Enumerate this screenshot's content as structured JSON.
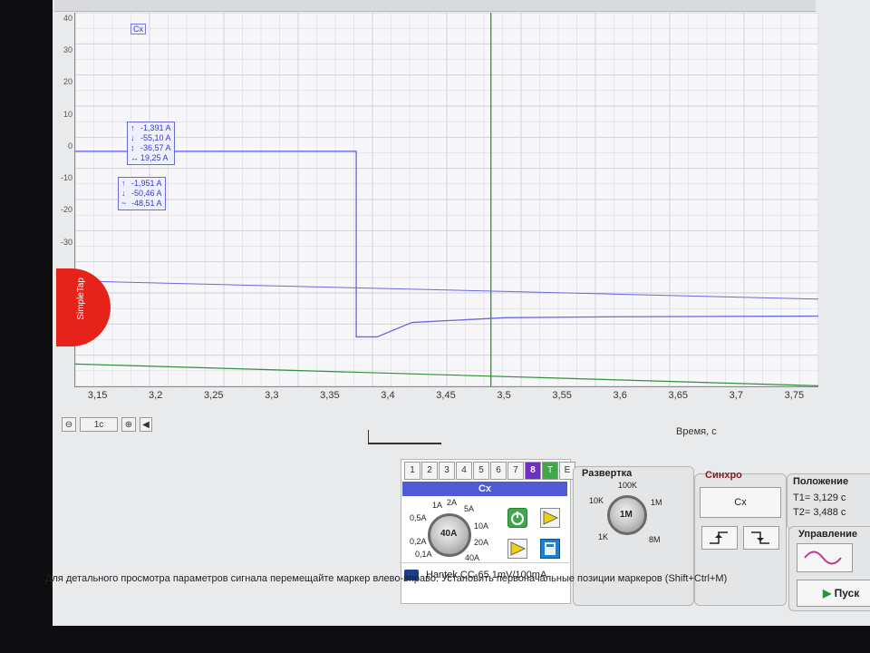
{
  "channel_tag": "Cx",
  "chart_data": {
    "type": "line",
    "xlabel": "Время, с",
    "x_ticks": [
      "3,15",
      "3,2",
      "3,25",
      "3,3",
      "3,35",
      "3,4",
      "3,45",
      "3,5",
      "3,55",
      "3,6",
      "3,65",
      "3,7",
      "3,75"
    ],
    "y_ticks": [
      "40",
      "30",
      "20",
      "10",
      "0",
      "-10",
      "-20",
      "-30"
    ],
    "xlim": [
      3.13,
      3.77
    ],
    "ylim": [
      -33,
      42
    ],
    "grid": true,
    "series": [
      {
        "x": [
          3.13,
          3.372,
          3.372,
          3.39,
          3.42,
          3.5,
          3.6,
          3.77
        ],
        "y": [
          -1.4,
          -1.4,
          -59.5,
          -59.5,
          -55,
          -53.5,
          -53.2,
          -53
        ]
      }
    ],
    "reference_lines": {
      "cursor_x": 3.488,
      "blue_h_level": -42,
      "green_h_level": -68
    }
  },
  "measure_box_1": [
    {
      "icon": "↑",
      "value": "-1,391 A"
    },
    {
      "icon": "↓",
      "value": "-55,10 A"
    },
    {
      "icon": "↕",
      "value": "-36,57 A"
    },
    {
      "icon": "↔",
      "value": "19,25 A"
    }
  ],
  "measure_box_2": [
    {
      "icon": "↑",
      "value": "-1,951 A"
    },
    {
      "icon": "↓",
      "value": "-50,46 A"
    },
    {
      "icon": "~",
      "value": "-48,51 A"
    }
  ],
  "simpletap_label": "SimpleTap",
  "nav": {
    "timebase": "1c",
    "zoom_icon": "⊕",
    "prev_icon": "◀"
  },
  "channel_panel": {
    "tabs": [
      "1",
      "2",
      "3",
      "4",
      "5",
      "6",
      "7",
      "8",
      "T",
      "E"
    ],
    "header": "Cx",
    "knob_center": "40A",
    "knob_labels": [
      "0,5A",
      "1A",
      "2A",
      "5A",
      "10A",
      "20A",
      "40A",
      "0,2A",
      "0,1A"
    ],
    "probe": "Hantek CC-65 1mV/100mA"
  },
  "sweep_panel": {
    "title": "Развертка",
    "knob_center": "1M",
    "knob_labels": [
      "100K",
      "10K",
      "1M",
      "8M",
      "1K"
    ]
  },
  "sync_panel": {
    "title": "Синхро",
    "source_button": "Cx"
  },
  "position_panel": {
    "title": "Положение",
    "t1": "T1= 3,129 c",
    "t2": "T2= 3,488 c"
  },
  "control_panel": {
    "title": "Управление",
    "run_button": "Пуск"
  },
  "status": {
    "line1": "Для детального просмотра параметров сигнала перемещайте маркер влево-вправо. Установить первоначальные позиции маркеров (Shift+Ctrl+M)"
  },
  "colors": {
    "trace": "#6b66e6",
    "grid": "#c9cfd9",
    "cursor": "#2f8f3a",
    "channel_accent": "#4f5bd5",
    "active_tab": "#6f2fc7"
  }
}
